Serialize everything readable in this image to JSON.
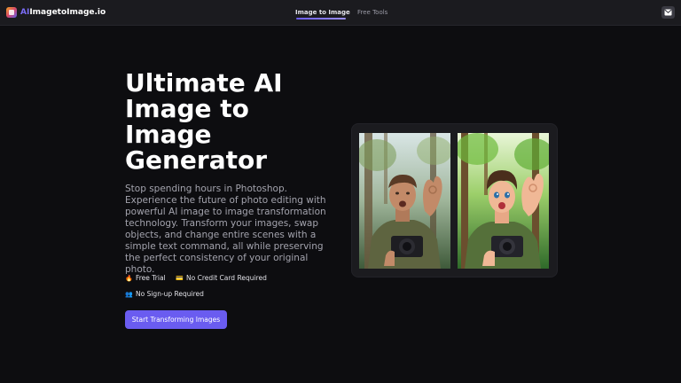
{
  "header": {
    "brand_prefix": "AI",
    "brand_rest": "ImagetoImage.io",
    "nav": [
      {
        "label": "Image to Image",
        "active": true
      },
      {
        "label": "Free Tools",
        "active": false
      }
    ],
    "mail_icon": "mail-icon"
  },
  "hero": {
    "title": "Ultimate AI Image to Image Generator",
    "description": "Stop spending hours in Photoshop. Experience the future of photo editing with powerful AI image to image transformation technology. Transform your images, swap objects, and change entire scenes with a simple text command, all while preserving the perfect consistency of your original photo.",
    "features": [
      {
        "icon": "fire-icon",
        "glyph": "🔥",
        "label": "Free Trial"
      },
      {
        "icon": "credit-card-icon",
        "glyph": "💳",
        "label": "No Credit Card Required"
      },
      {
        "icon": "users-icon",
        "glyph": "👥",
        "label": "No Sign-up Required"
      }
    ],
    "cta_label": "Start Transforming Images"
  },
  "comparison": {
    "left_image": "original-photo-man-with-camera-forest",
    "right_image": "anime-style-man-with-camera-forest"
  },
  "colors": {
    "background": "#0d0d10",
    "header": "#1b1b1f",
    "accent": "#6a5cf0",
    "muted_text": "#a3a3ad"
  }
}
